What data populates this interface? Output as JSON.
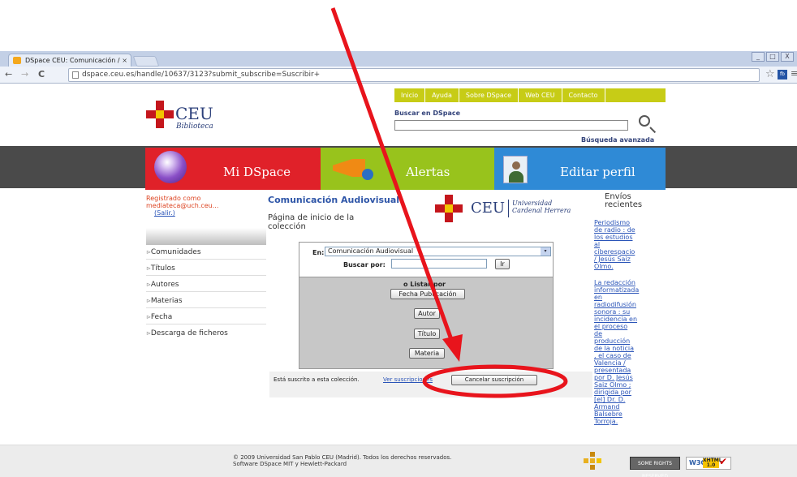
{
  "browser": {
    "tab_title": "DSpace CEU: Comunicación /",
    "tab_close": "×",
    "back_icon": "←",
    "forward_icon": "→",
    "reload_icon": "C",
    "url": "dspace.ceu.es/handle/10637/3123?submit_subscribe=Suscribir+",
    "star_icon": "☆",
    "ext_icon": "fb",
    "menu_icon": "≡",
    "win_buttons": [
      "_",
      "□",
      "X"
    ]
  },
  "topnav": [
    "Inicio",
    "Ayuda",
    "Sobre DSpace",
    "Web CEU",
    "Contacto"
  ],
  "logo": {
    "name": "CEU",
    "sub": "Biblioteca"
  },
  "search": {
    "label": "Buscar en DSpace",
    "advanced": "Búsqueda avanzada"
  },
  "band": {
    "mi_dspace": "Mi DSpace",
    "alertas": "Alertas",
    "editar": "Editar perfil"
  },
  "user": {
    "registered": "Registrado como",
    "email": "mediateca@uch.ceu...",
    "logout": "(Salir.)"
  },
  "sidebar": [
    "Comunidades",
    "Títulos",
    "Autores",
    "Materias",
    "Fecha",
    "Descarga de ficheros"
  ],
  "sidebar_arrow": "⊳",
  "collection": {
    "title": "Comunicación Audiovisual",
    "subtitle_1": "Página de inicio de la",
    "subtitle_2": "colección"
  },
  "ceu2": {
    "name": "CEU",
    "sub1": "Universidad",
    "sub2": "Cardenal Herrera"
  },
  "browse": {
    "en_label": "En:",
    "en_value": "Comunicación Audiovisual",
    "dropdown_icon": "▾",
    "buscar_label": "Buscar por:",
    "ir": "Ir",
    "o_listar": "o Listar por",
    "fecha": "Fecha Publicación",
    "autor": "Autor",
    "titulo": "Título",
    "materia": "Materia"
  },
  "subscription": {
    "text": "Está suscrito a esta colección.",
    "link": "Ver suscripciones",
    "cancel": "Cancelar suscripción"
  },
  "recent": {
    "title_1": "Envíos",
    "title_2": "recientes",
    "items": [
      [
        "Periodismo",
        "de radio : de",
        "los estudios",
        "al",
        "ciberespacio",
        "/ Jesús Saiz",
        "Olmo."
      ],
      [
        "La redacción",
        "informatizada",
        "en",
        "radiodifusión",
        "sonora : su",
        "incidencia en",
        "el proceso",
        "de",
        "producción",
        "de la noticia",
        ", el caso de",
        "Valencia /",
        "presentada",
        "por D. Jesús",
        "Saiz Olmo ;",
        "dirigida por",
        "[el] Dr. D.",
        "Armand",
        "Balsebre",
        "Torroja."
      ]
    ]
  },
  "footer": {
    "line1": "© 2009 Universidad San Pablo CEU (Madrid). Todos los derechos reservados.",
    "line2": "Software DSpace MIT y Hewlett-Packard",
    "cc": "SOME RIGHTS RESERVED",
    "w3c": "W3C",
    "xhtml": "XHTML 1.0",
    "check": "✔"
  },
  "colors": {
    "annotation": "#e8141c",
    "ceu_red": "#c4161c",
    "ceu_blue": "#2b3f7a",
    "green": "#98c31c",
    "blue": "#2f8ad6"
  }
}
